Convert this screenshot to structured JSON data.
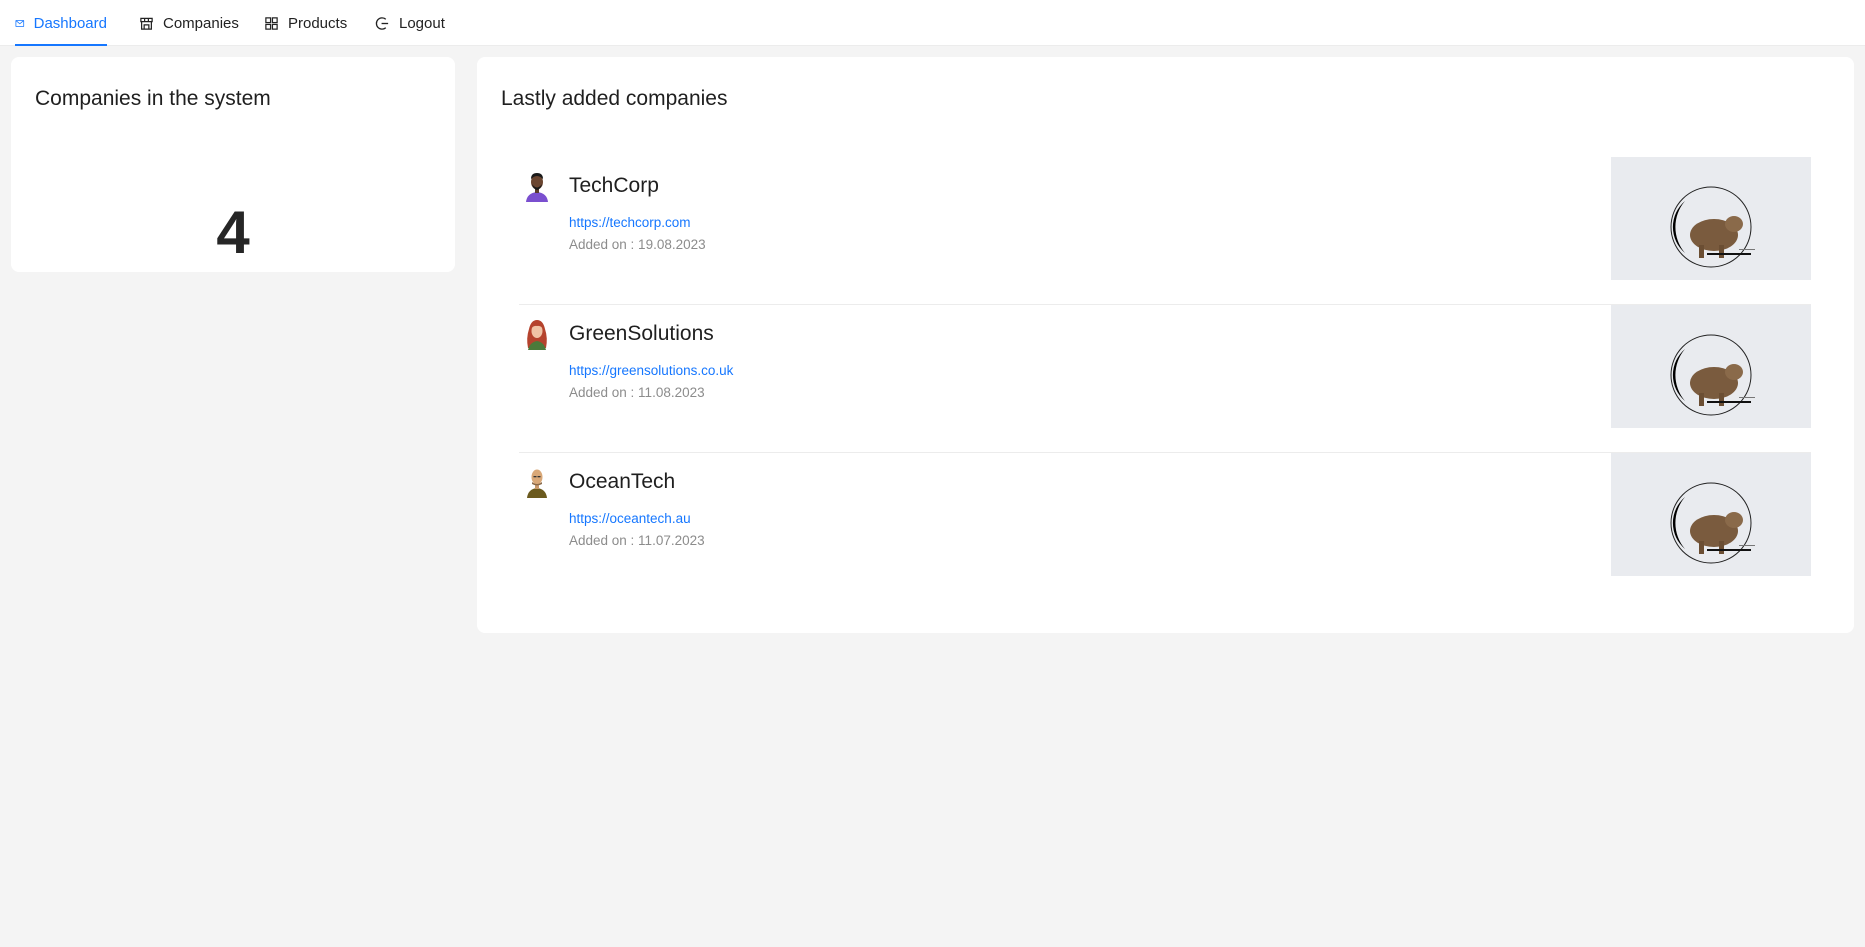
{
  "nav": {
    "items": [
      {
        "label": "Dashboard",
        "icon": "mail-icon",
        "active": true
      },
      {
        "label": "Companies",
        "icon": "shop-icon",
        "active": false
      },
      {
        "label": "Products",
        "icon": "product-icon",
        "active": false
      },
      {
        "label": "Logout",
        "icon": "logout-icon",
        "active": false
      }
    ],
    "accent_color": "#1677ff"
  },
  "stats": {
    "title": "Companies in the system",
    "value": "4"
  },
  "latest": {
    "title": "Lastly added companies",
    "companies": [
      {
        "name": "TechCorp",
        "url": "https://techcorp.com",
        "added": "Added on : 19.08.2023",
        "avatar": "man-dark-avatar"
      },
      {
        "name": "GreenSolutions",
        "url": "https://greensolutions.co.uk",
        "added": "Added on : 11.08.2023",
        "avatar": "woman-redhair-avatar"
      },
      {
        "name": "OceanTech",
        "url": "https://oceantech.au",
        "added": "Added on : 11.07.2023",
        "avatar": "man-bald-avatar"
      }
    ],
    "thumbnail": "bear-logo-image"
  }
}
